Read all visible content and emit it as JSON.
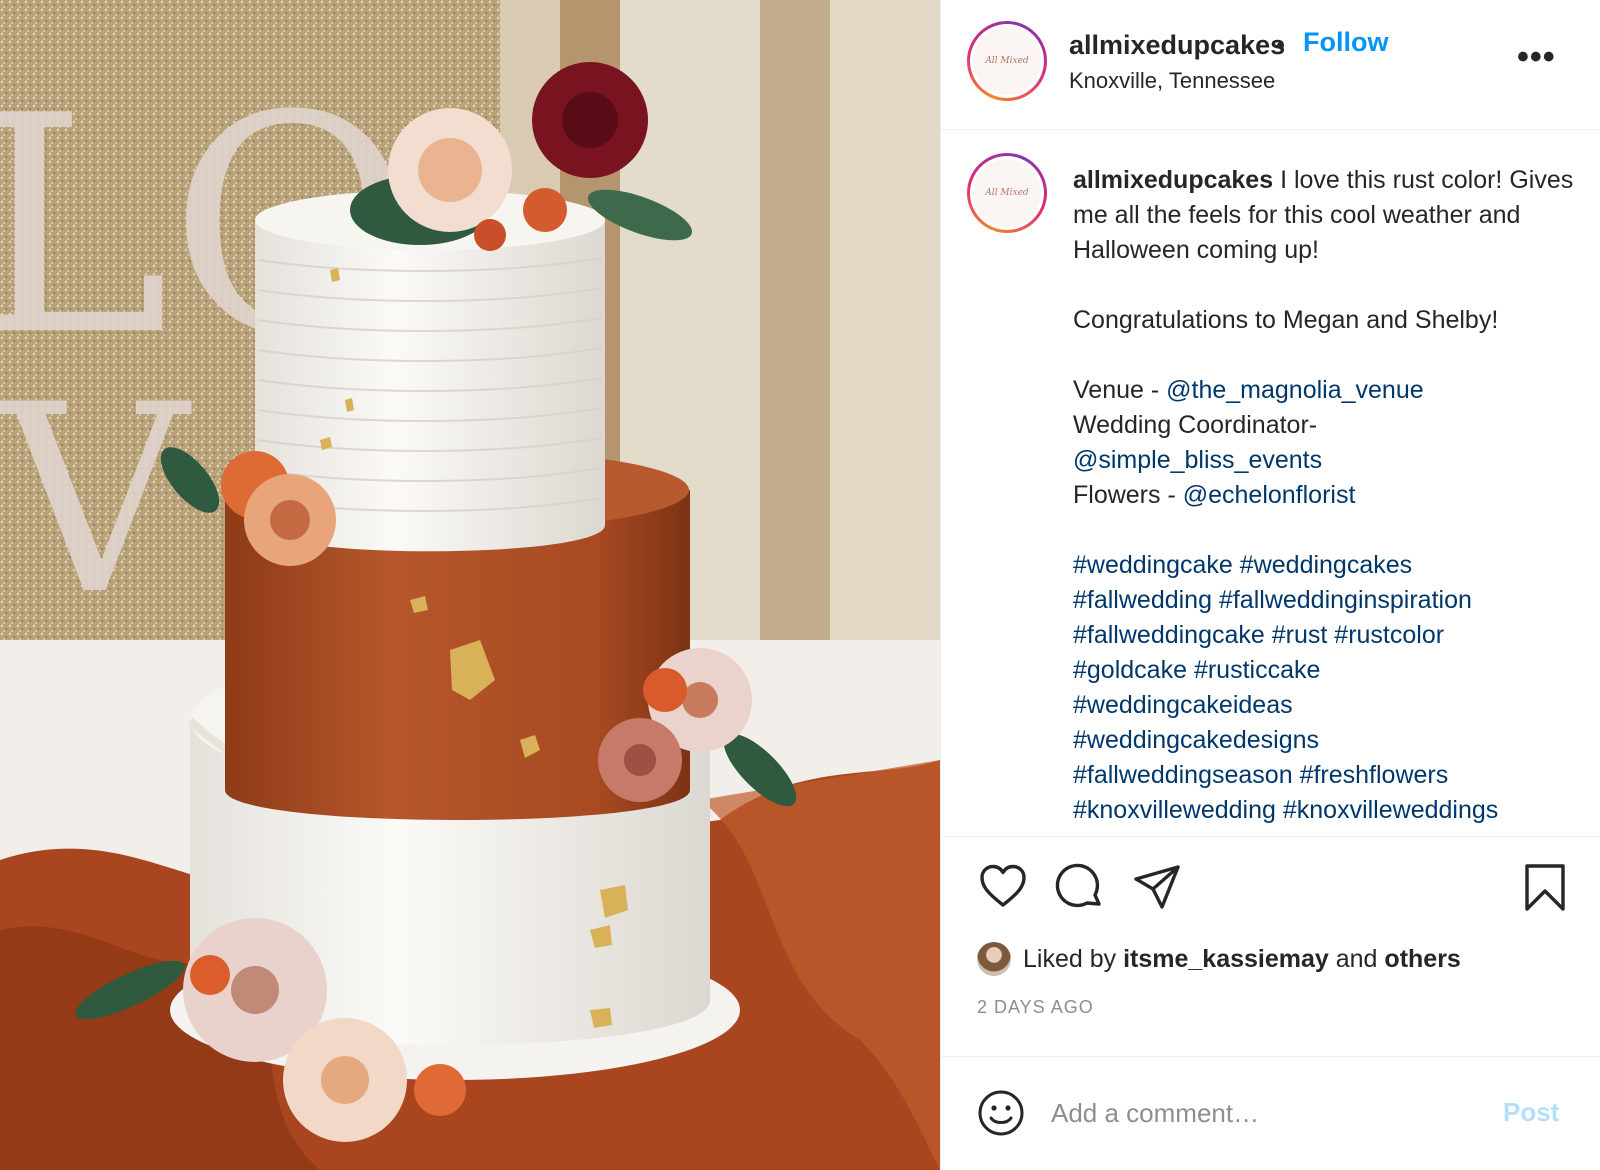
{
  "post": {
    "username": "allmixedupcakes",
    "dot": "•",
    "follow_label": "Follow",
    "location": "Knoxville, Tennessee",
    "more_icon": "more-options-icon",
    "avatar_text": "All Mixed"
  },
  "photo": {
    "backdrop_letters": [
      "LO",
      "V"
    ],
    "icon": "wedding-cake-photo"
  },
  "caption": {
    "username": "allmixedupcakes",
    "line1": "I love this rust color! Gives me all the feels for this cool weather and Halloween coming up!",
    "line2": "Congratulations to Megan and Shelby!",
    "venue_label": "Venue - ",
    "venue_handle": "@the_magnolia_venue",
    "coordinator_label": "Wedding Coordinator-",
    "coordinator_handle": "@simple_bliss_events",
    "flowers_label": "Flowers - ",
    "flowers_handle": "@echelonflorist",
    "hashtags": [
      "#weddingcake",
      "#weddingcakes",
      "#fallwedding",
      "#fallweddinginspiration",
      "#fallweddingcake",
      "#rust",
      "#rustcolor",
      "#goldcake",
      "#rusticcake",
      "#weddingcakeideas",
      "#weddingcakedesigns",
      "#fallweddingseason",
      "#freshflowers",
      "#knoxvillewedding",
      "#knoxvilleweddings"
    ]
  },
  "actions": {
    "like_icon": "heart-icon",
    "comment_icon": "comment-icon",
    "share_icon": "paper-plane-icon",
    "save_icon": "bookmark-icon",
    "liked_prefix": "Liked by ",
    "liked_user": "itsme_kassiemay",
    "liked_and": " and ",
    "liked_others": "others",
    "time_ago": "2 DAYS AGO"
  },
  "comment": {
    "placeholder": "Add a comment…",
    "post_label": "Post",
    "emoji_icon": "emoji-icon"
  },
  "colors": {
    "accent": "#0095f6",
    "link": "#00376b",
    "muted": "#8e8e8e",
    "post_disabled": "#b2dffc",
    "rust": "#b5562b"
  }
}
